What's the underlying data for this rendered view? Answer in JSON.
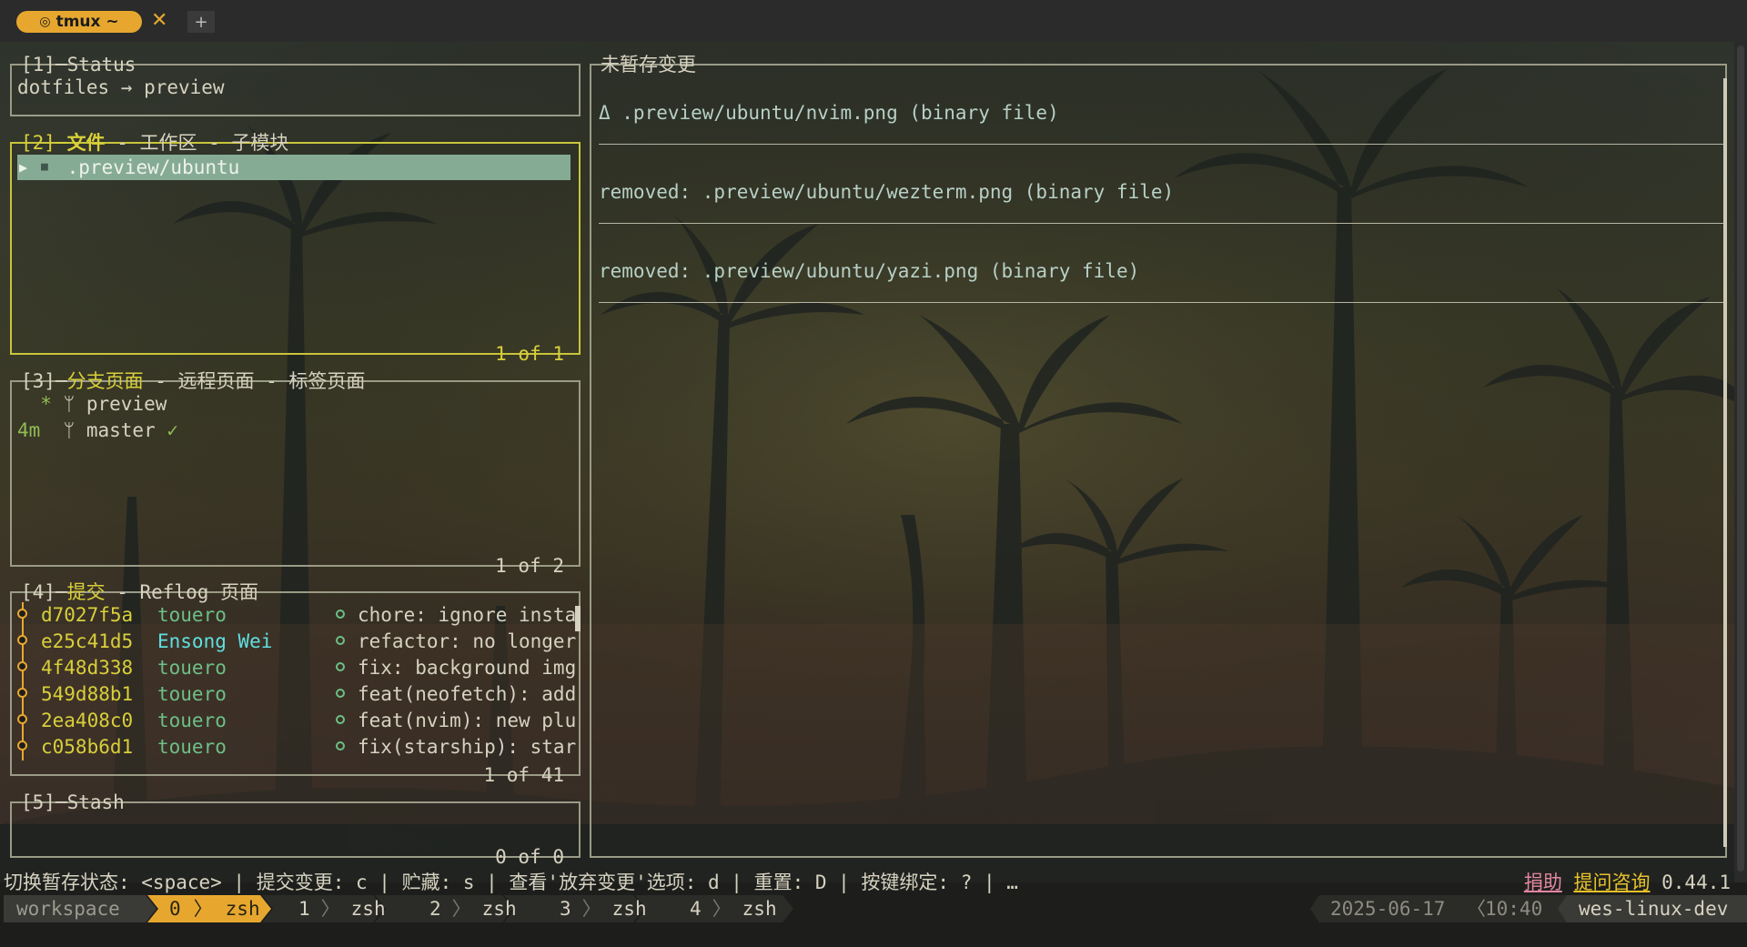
{
  "tab": {
    "title": "tmux ~",
    "close": "✕",
    "plus": "+"
  },
  "status_panel": {
    "title": "[1]─Status",
    "text": "dotfiles → preview"
  },
  "files_panel": {
    "title_num": "[2]─",
    "title_sel": "文件",
    "title_rest": " - 工作区 - 子模块",
    "row_arrow": "▶",
    "row_folder": "■",
    "row_text": " .preview/ubuntu",
    "footer": "1 of 1"
  },
  "branches_panel": {
    "title_num": "[3]─",
    "title_sel": "分支页面",
    "title_rest": " - 远程页面 - 标签页面",
    "branches": [
      {
        "age": "  *",
        "icon": "",
        "name": "preview",
        "mark": ""
      },
      {
        "age": "4m ",
        "icon": "",
        "name": "master",
        "mark": " ✓"
      }
    ],
    "footer": "1 of 2"
  },
  "commits_panel": {
    "title_num": "[4]─",
    "title_sel": "提交",
    "title_rest": " - Reflog 页面",
    "commits": [
      {
        "hash": "d7027f5a",
        "author": "touero",
        "author_color": "#6dbf86",
        "msg": "chore: ignore insta"
      },
      {
        "hash": "e25c41d5",
        "author": "Ensong Wei",
        "author_color": "#5fe0e0",
        "msg": "refactor: no longer"
      },
      {
        "hash": "4f48d338",
        "author": "touero",
        "author_color": "#6dbf86",
        "msg": "fix: background img"
      },
      {
        "hash": "549d88b1",
        "author": "touero",
        "author_color": "#6dbf86",
        "msg": "feat(neofetch): add"
      },
      {
        "hash": "2ea408c0",
        "author": "touero",
        "author_color": "#6dbf86",
        "msg": "feat(nvim): new plu"
      },
      {
        "hash": "c058b6d1",
        "author": "touero",
        "author_color": "#6dbf86",
        "msg": "fix(starship): star"
      }
    ],
    "footer": "1 of 41"
  },
  "stash_panel": {
    "title": "[5]─Stash",
    "footer": "0 of 0"
  },
  "diff_panel": {
    "title": "未暂存变更",
    "lines": [
      "Δ .preview/ubuntu/nvim.png (binary file)",
      "removed: .preview/ubuntu/wezterm.png (binary file)",
      "removed: .preview/ubuntu/yazi.png (binary file)"
    ]
  },
  "helpbar": {
    "keys": "切换暂存状态: <space> | 提交变更: c | 贮藏: s | 查看'放弃变更'选项: d | 重置: D | 按键绑定: ? | …",
    "donate": "捐助",
    "ask": "提问咨询",
    "version": "0.44.1"
  },
  "statusbar": {
    "session": "workspace",
    "windows": [
      {
        "index": "0",
        "name": "zsh",
        "active": true
      },
      {
        "index": "1",
        "name": "zsh",
        "active": false
      },
      {
        "index": "2",
        "name": "zsh",
        "active": false
      },
      {
        "index": "3",
        "name": "zsh",
        "active": false
      },
      {
        "index": "4",
        "name": "zsh",
        "active": false
      }
    ],
    "date": "2025-06-17",
    "time": "10:40",
    "host": "wes-linux-dev"
  },
  "colors": {
    "accent": "#e7a72f",
    "active_border": "#c9c53a",
    "highlight_row": "#86ab94"
  }
}
